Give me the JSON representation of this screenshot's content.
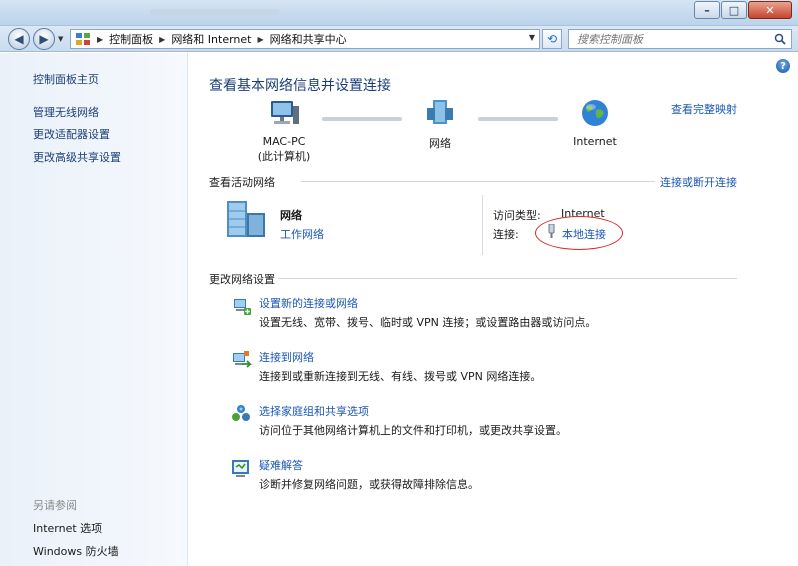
{
  "addressbar": {
    "breadcrumbs": [
      "控制面板",
      "网络和 Internet",
      "网络和共享中心"
    ],
    "search_placeholder": "搜索控制面板"
  },
  "sidebar": {
    "items": [
      "控制面板主页",
      "管理无线网络",
      "更改适配器设置",
      "更改高级共享设置"
    ],
    "see_also_title": "另请参阅",
    "see_also": [
      "Internet 选项",
      "Windows 防火墙"
    ]
  },
  "main": {
    "title": "查看基本网络信息并设置连接",
    "full_map_link": "查看完整映射",
    "nodes": [
      {
        "label": "MAC-PC",
        "sublabel": "(此计算机)"
      },
      {
        "label": "网络"
      },
      {
        "label": "Internet"
      }
    ],
    "active_section_title": "查看活动网络",
    "connect_disconnect_link": "连接或断开连接",
    "active_network": {
      "name": "网络",
      "type_link": "工作网络",
      "access_type_label": "访问类型:",
      "access_type_value": "Internet",
      "connection_label": "连接:",
      "connection_value": "本地连接"
    },
    "change_section_title": "更改网络设置",
    "tasks": [
      {
        "link": "设置新的连接或网络",
        "desc": "设置无线、宽带、拨号、临时或 VPN 连接；或设置路由器或访问点。"
      },
      {
        "link": "连接到网络",
        "desc": "连接到或重新连接到无线、有线、拨号或 VPN 网络连接。"
      },
      {
        "link": "选择家庭组和共享选项",
        "desc": "访问位于其他网络计算机上的文件和打印机，或更改共享设置。"
      },
      {
        "link": "疑难解答",
        "desc": "诊断并修复网络问题，或获得故障排除信息。"
      }
    ]
  },
  "colors": {
    "link": "#1c57b5",
    "title": "#1a3e78",
    "annotation": "#d62a2a"
  }
}
